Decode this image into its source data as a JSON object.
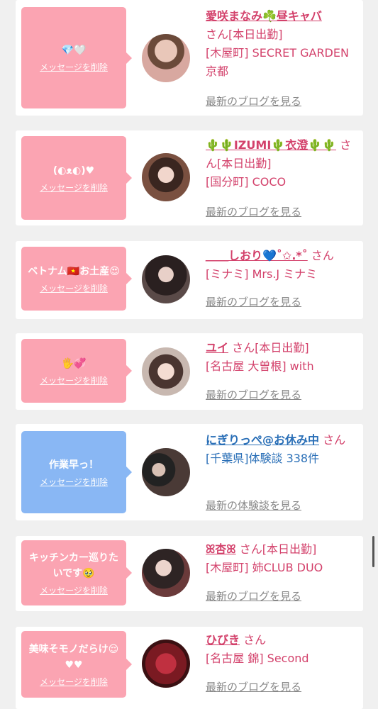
{
  "delete_label": "メッセージを削除",
  "blog_link": "最新のブログを見る",
  "review_link": "最新の体験談を見る",
  "suffix": "さん",
  "cards": [
    {
      "message": "💎🤍",
      "name": "愛咲まなみ☘️昼キャバ",
      "status": "[本日出勤]",
      "shop": "[木屋町] SECRET GARDEN 京都"
    },
    {
      "message": "(◐ᴥ◐)♥",
      "name": "🌵🌵IZUMI🌵衣澄🌵🌵",
      "status": "[本日出勤]",
      "shop": "[国分町] COCO"
    },
    {
      "message": "ベトナム🇻🇳お土産😍",
      "name": "＿＿しおり💙˚✩.*˚",
      "status": "",
      "shop": "[ミナミ] Mrs.J ミナミ"
    },
    {
      "message": "🖐💞",
      "name": "ユイ",
      "status": "[本日出勤]",
      "shop": "[名古屋 大曽根] with"
    },
    {
      "message": "作業早っ！",
      "name": "にぎりっぺ@お休み中",
      "status": "",
      "shop": "[千葉県]体験談 338件"
    },
    {
      "message": "キッチンカー巡りたいです🥹",
      "name": "ꕤ杏ꕤ",
      "status": "[本日出勤]",
      "shop": "[木屋町] 姉CLUB DUO"
    },
    {
      "message": "美味そモノだらけ😌♥♥",
      "name": "ひびき",
      "status": "",
      "shop": "[名古屋 錦] Second"
    }
  ],
  "colors": {
    "pink": "#fba4b2",
    "blue": "#89b7f4",
    "name": "#d3416b",
    "link_blue": "#2a6fb7"
  }
}
